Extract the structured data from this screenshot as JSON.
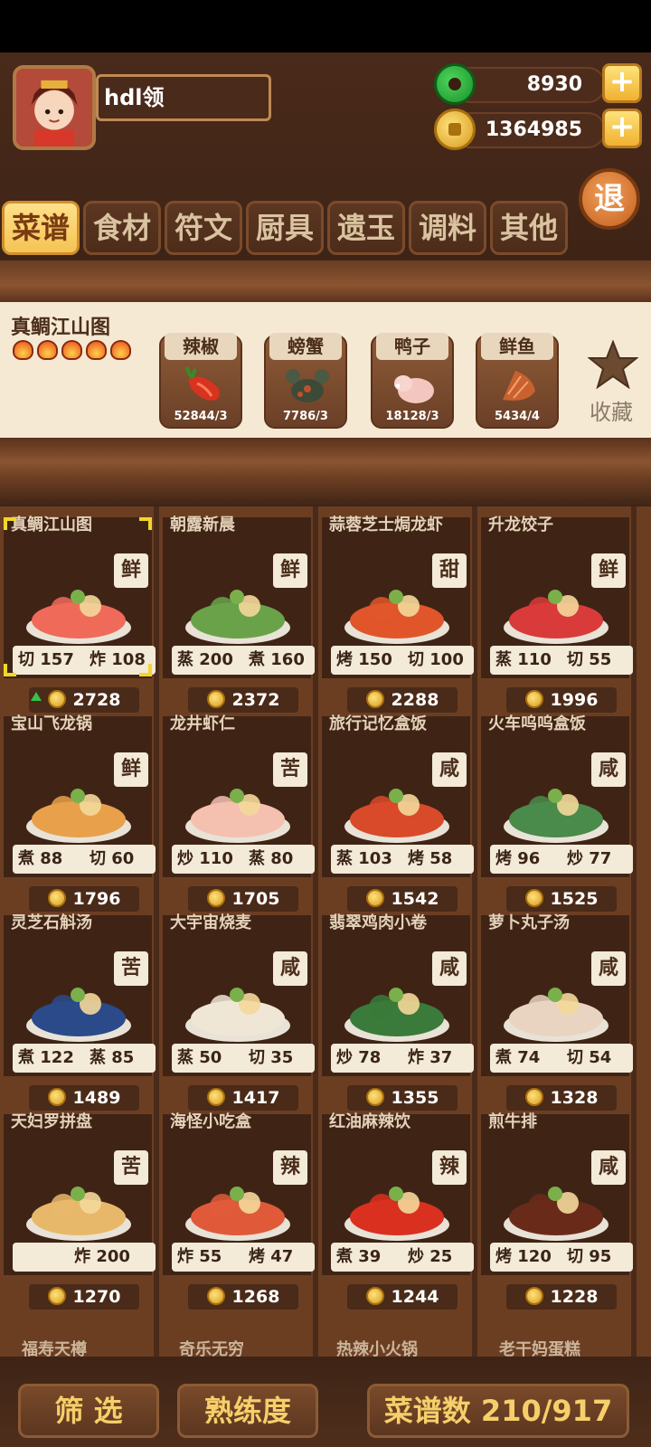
{
  "player": {
    "name": "hdl领"
  },
  "currency": {
    "jade": "8930",
    "coins": "1364985",
    "plus_label": "+"
  },
  "exit_label": "退",
  "tabs": [
    "菜谱",
    "食材",
    "符文",
    "厨具",
    "遗玉",
    "调料",
    "其他"
  ],
  "selected_recipe": {
    "title": "真鲷江山图",
    "flames": 5,
    "ingredients": [
      {
        "name": "辣椒",
        "count": "52844/3",
        "icon": "chili-icon",
        "color": "#d8331f"
      },
      {
        "name": "螃蟹",
        "count": "7786/3",
        "icon": "crab-icon",
        "color": "#3d4a38"
      },
      {
        "name": "鸭子",
        "count": "18128/3",
        "icon": "duck-icon",
        "color": "#f4c6c0"
      },
      {
        "name": "鲜鱼",
        "count": "5434/4",
        "icon": "fish-icon",
        "color": "#c9612e"
      }
    ],
    "favorite_label": "收藏"
  },
  "recipes": [
    {
      "name": "真鲷江山图",
      "flavor": "鲜",
      "skills": [
        [
          "切",
          "157"
        ],
        [
          "炸",
          "108"
        ]
      ],
      "price": "2728",
      "color": "#f06a5a",
      "selected": true,
      "upgrade": true
    },
    {
      "name": "朝露新晨",
      "flavor": "鲜",
      "skills": [
        [
          "蒸",
          "200"
        ],
        [
          "煮",
          "160"
        ]
      ],
      "price": "2372",
      "color": "#6aa24a"
    },
    {
      "name": "蒜蓉芝士焗龙虾",
      "flavor": "甜",
      "skills": [
        [
          "烤",
          "150"
        ],
        [
          "切",
          "100"
        ]
      ],
      "price": "2288",
      "color": "#e0562a"
    },
    {
      "name": "升龙饺子",
      "flavor": "鲜",
      "skills": [
        [
          "蒸",
          "110"
        ],
        [
          "切",
          "55"
        ]
      ],
      "price": "1996",
      "color": "#d93b3b"
    },
    {
      "name": "宝山飞龙锅",
      "flavor": "鲜",
      "skills": [
        [
          "煮",
          "88"
        ],
        [
          "切",
          "60"
        ]
      ],
      "price": "1796",
      "color": "#e8a04a"
    },
    {
      "name": "龙井虾仁",
      "flavor": "苦",
      "skills": [
        [
          "炒",
          "110"
        ],
        [
          "蒸",
          "80"
        ]
      ],
      "price": "1705",
      "color": "#f4c0b0"
    },
    {
      "name": "旅行记忆盒饭",
      "flavor": "咸",
      "skills": [
        [
          "蒸",
          "103"
        ],
        [
          "烤",
          "58"
        ]
      ],
      "price": "1542",
      "color": "#d94a2a"
    },
    {
      "name": "火车呜呜盒饭",
      "flavor": "咸",
      "skills": [
        [
          "烤",
          "96"
        ],
        [
          "炒",
          "77"
        ]
      ],
      "price": "1525",
      "color": "#4a8a4a"
    },
    {
      "name": "灵芝石斛汤",
      "flavor": "苦",
      "skills": [
        [
          "煮",
          "122"
        ],
        [
          "蒸",
          "85"
        ]
      ],
      "price": "1489",
      "color": "#2a4a8a"
    },
    {
      "name": "大宇宙烧麦",
      "flavor": "咸",
      "skills": [
        [
          "蒸",
          "50"
        ],
        [
          "切",
          "35"
        ]
      ],
      "price": "1417",
      "color": "#efe6d6"
    },
    {
      "name": "翡翠鸡肉小卷",
      "flavor": "咸",
      "skills": [
        [
          "炒",
          "78"
        ],
        [
          "炸",
          "37"
        ]
      ],
      "price": "1355",
      "color": "#3a7a3a"
    },
    {
      "name": "萝卜丸子汤",
      "flavor": "咸",
      "skills": [
        [
          "煮",
          "74"
        ],
        [
          "切",
          "54"
        ]
      ],
      "price": "1328",
      "color": "#e8d4c0"
    },
    {
      "name": "天妇罗拼盘",
      "flavor": "苦",
      "skills": [
        [
          "炸",
          "200"
        ]
      ],
      "price": "1270",
      "color": "#e8b86a"
    },
    {
      "name": "海怪小吃盒",
      "flavor": "辣",
      "skills": [
        [
          "炸",
          "55"
        ],
        [
          "烤",
          "47"
        ]
      ],
      "price": "1268",
      "color": "#e05a3a"
    },
    {
      "name": "红油麻辣饮",
      "flavor": "辣",
      "skills": [
        [
          "煮",
          "39"
        ],
        [
          "炒",
          "25"
        ]
      ],
      "price": "1244",
      "color": "#d93020"
    },
    {
      "name": "煎牛排",
      "flavor": "咸",
      "skills": [
        [
          "烤",
          "120"
        ],
        [
          "切",
          "95"
        ]
      ],
      "price": "1228",
      "color": "#6a2a1a"
    }
  ],
  "next_row_peek": [
    "福寿天樽",
    "奇乐无穷",
    "热辣小火锅",
    "老干妈蛋糕"
  ],
  "bottom": {
    "filter_label": "筛 选",
    "proficiency_label": "熟练度",
    "recipe_count_label": "菜谱数 210/917"
  }
}
